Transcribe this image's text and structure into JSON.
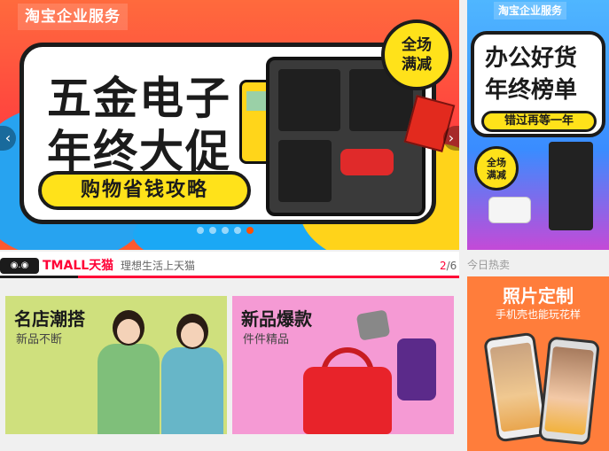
{
  "main_banner": {
    "brand": "淘宝企业服务",
    "headline_line1": "五金电子",
    "headline_line2": "年终大促",
    "cta": "购物省钱攻略",
    "badge_line1": "全场",
    "badge_line2": "满减",
    "prev_label": "‹",
    "next_label": "›",
    "dots_count": 5,
    "active_dot": 4
  },
  "side_banner": {
    "brand": "淘宝企业服务",
    "title_line1": "办公好货",
    "title_line2": "年终榜单",
    "pill": "错过再等一年",
    "badge_line1": "全场",
    "badge_line2": "满减"
  },
  "tmall": {
    "cat_label": "◉.◉",
    "logo": "TMALL天猫",
    "slogan": "理想生活上天猫",
    "page_current": "2",
    "page_total": "/6"
  },
  "today_hot": "今日热卖",
  "panels": [
    {
      "title": "名店潮搭",
      "subtitle": "新品不断"
    },
    {
      "title": "新品爆款",
      "subtitle": "件件精品"
    }
  ],
  "side_panel": {
    "title": "照片定制",
    "subtitle": "手机壳也能玩花样"
  },
  "colors": {
    "tmall_red": "#ff0036",
    "taobao_orange": "#ff5000",
    "cta_yellow": "#ffe21a"
  }
}
